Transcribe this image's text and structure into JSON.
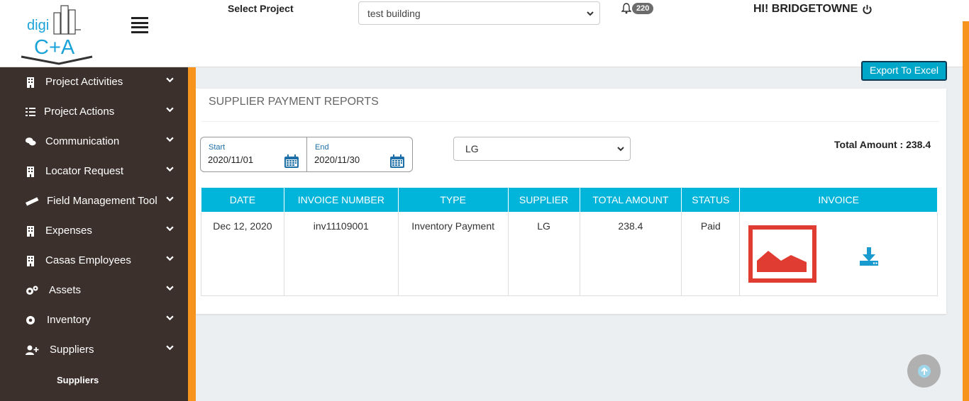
{
  "header": {
    "logo_text_top": "digi",
    "logo_text_bottom": "C+A",
    "select_project_label": "Select Project",
    "project_selected": "test building",
    "notification_count": "220",
    "greeting": "HI! BRIDGETOWNE"
  },
  "sidebar": {
    "items": [
      {
        "label": "Project Activities",
        "icon": "building-icon"
      },
      {
        "label": "Project Actions",
        "icon": "list-icon"
      },
      {
        "label": "Communication",
        "icon": "chat-icon"
      },
      {
        "label": "Locator Request",
        "icon": "building-icon"
      },
      {
        "label": "Field Management Tool",
        "icon": "ruler-icon"
      },
      {
        "label": "Expenses",
        "icon": "building-icon"
      },
      {
        "label": "Casas Employees",
        "icon": "building-icon"
      },
      {
        "label": "Assets",
        "icon": "gears-icon"
      },
      {
        "label": "Inventory",
        "icon": "gear-icon"
      },
      {
        "label": "Suppliers",
        "icon": "user-plus-icon"
      }
    ],
    "sub_item": "Suppliers"
  },
  "main": {
    "export_button": "Export To Excel",
    "title": "SUPPLIER PAYMENT REPORTS",
    "date_range": {
      "start_label": "Start",
      "start_value": "2020/11/01",
      "end_label": "End",
      "end_value": "2020/11/30"
    },
    "supplier_selected": "LG",
    "total_amount": "Total Amount : 238.4",
    "table": {
      "headers": [
        "DATE",
        "INVOICE NUMBER",
        "TYPE",
        "SUPPLIER",
        "TOTAL AMOUNT",
        "STATUS",
        "INVOICE"
      ],
      "rows": [
        {
          "date": "Dec 12, 2020",
          "invoice_number": "inv11109001",
          "type": "Inventory Payment",
          "supplier": "LG",
          "total_amount": "238.4",
          "status": "Paid"
        }
      ]
    }
  },
  "colors": {
    "accent": "#00b4da",
    "sidebar": "#3b302c",
    "stripe": "#f7941d",
    "invoice_image": "#e03c31"
  }
}
